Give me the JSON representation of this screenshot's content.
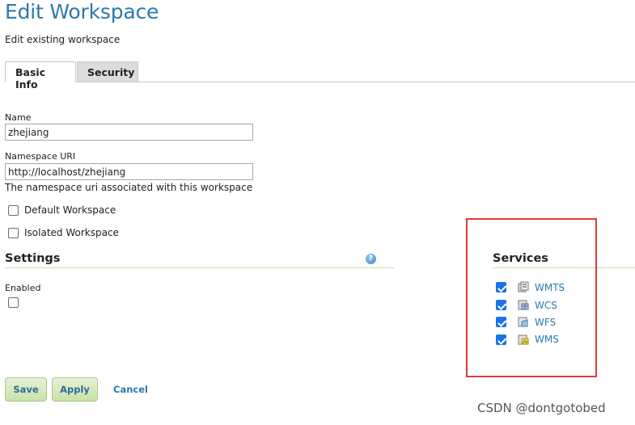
{
  "page": {
    "title": "Edit Workspace",
    "subtitle": "Edit existing workspace"
  },
  "tabs": [
    {
      "label": "Basic Info",
      "active": true
    },
    {
      "label": "Security",
      "active": false
    }
  ],
  "form": {
    "name_label": "Name",
    "name_value": "zhejiang",
    "namespace_label": "Namespace URI",
    "namespace_value": "http://localhost/zhejiang",
    "namespace_help": "The namespace uri associated with this workspace",
    "default_label": "Default Workspace",
    "default_checked": false,
    "isolated_label": "Isolated Workspace",
    "isolated_checked": false
  },
  "settings": {
    "heading": "Settings",
    "enabled_label": "Enabled",
    "enabled_checked": false
  },
  "services": {
    "heading": "Services",
    "items": [
      {
        "label": "WMTS",
        "checked": true
      },
      {
        "label": "WCS",
        "checked": true
      },
      {
        "label": "WFS",
        "checked": true
      },
      {
        "label": "WMS",
        "checked": true
      }
    ]
  },
  "buttons": {
    "save": "Save",
    "apply": "Apply",
    "cancel": "Cancel"
  },
  "watermark": "CSDN @dontgotobed",
  "colors": {
    "title": "#2a7ab0",
    "link": "#2a7ab0",
    "checkbox_checked": "#1a73e8",
    "highlight_box": "#e33a3a",
    "button_bg": "#c9e2a9"
  }
}
